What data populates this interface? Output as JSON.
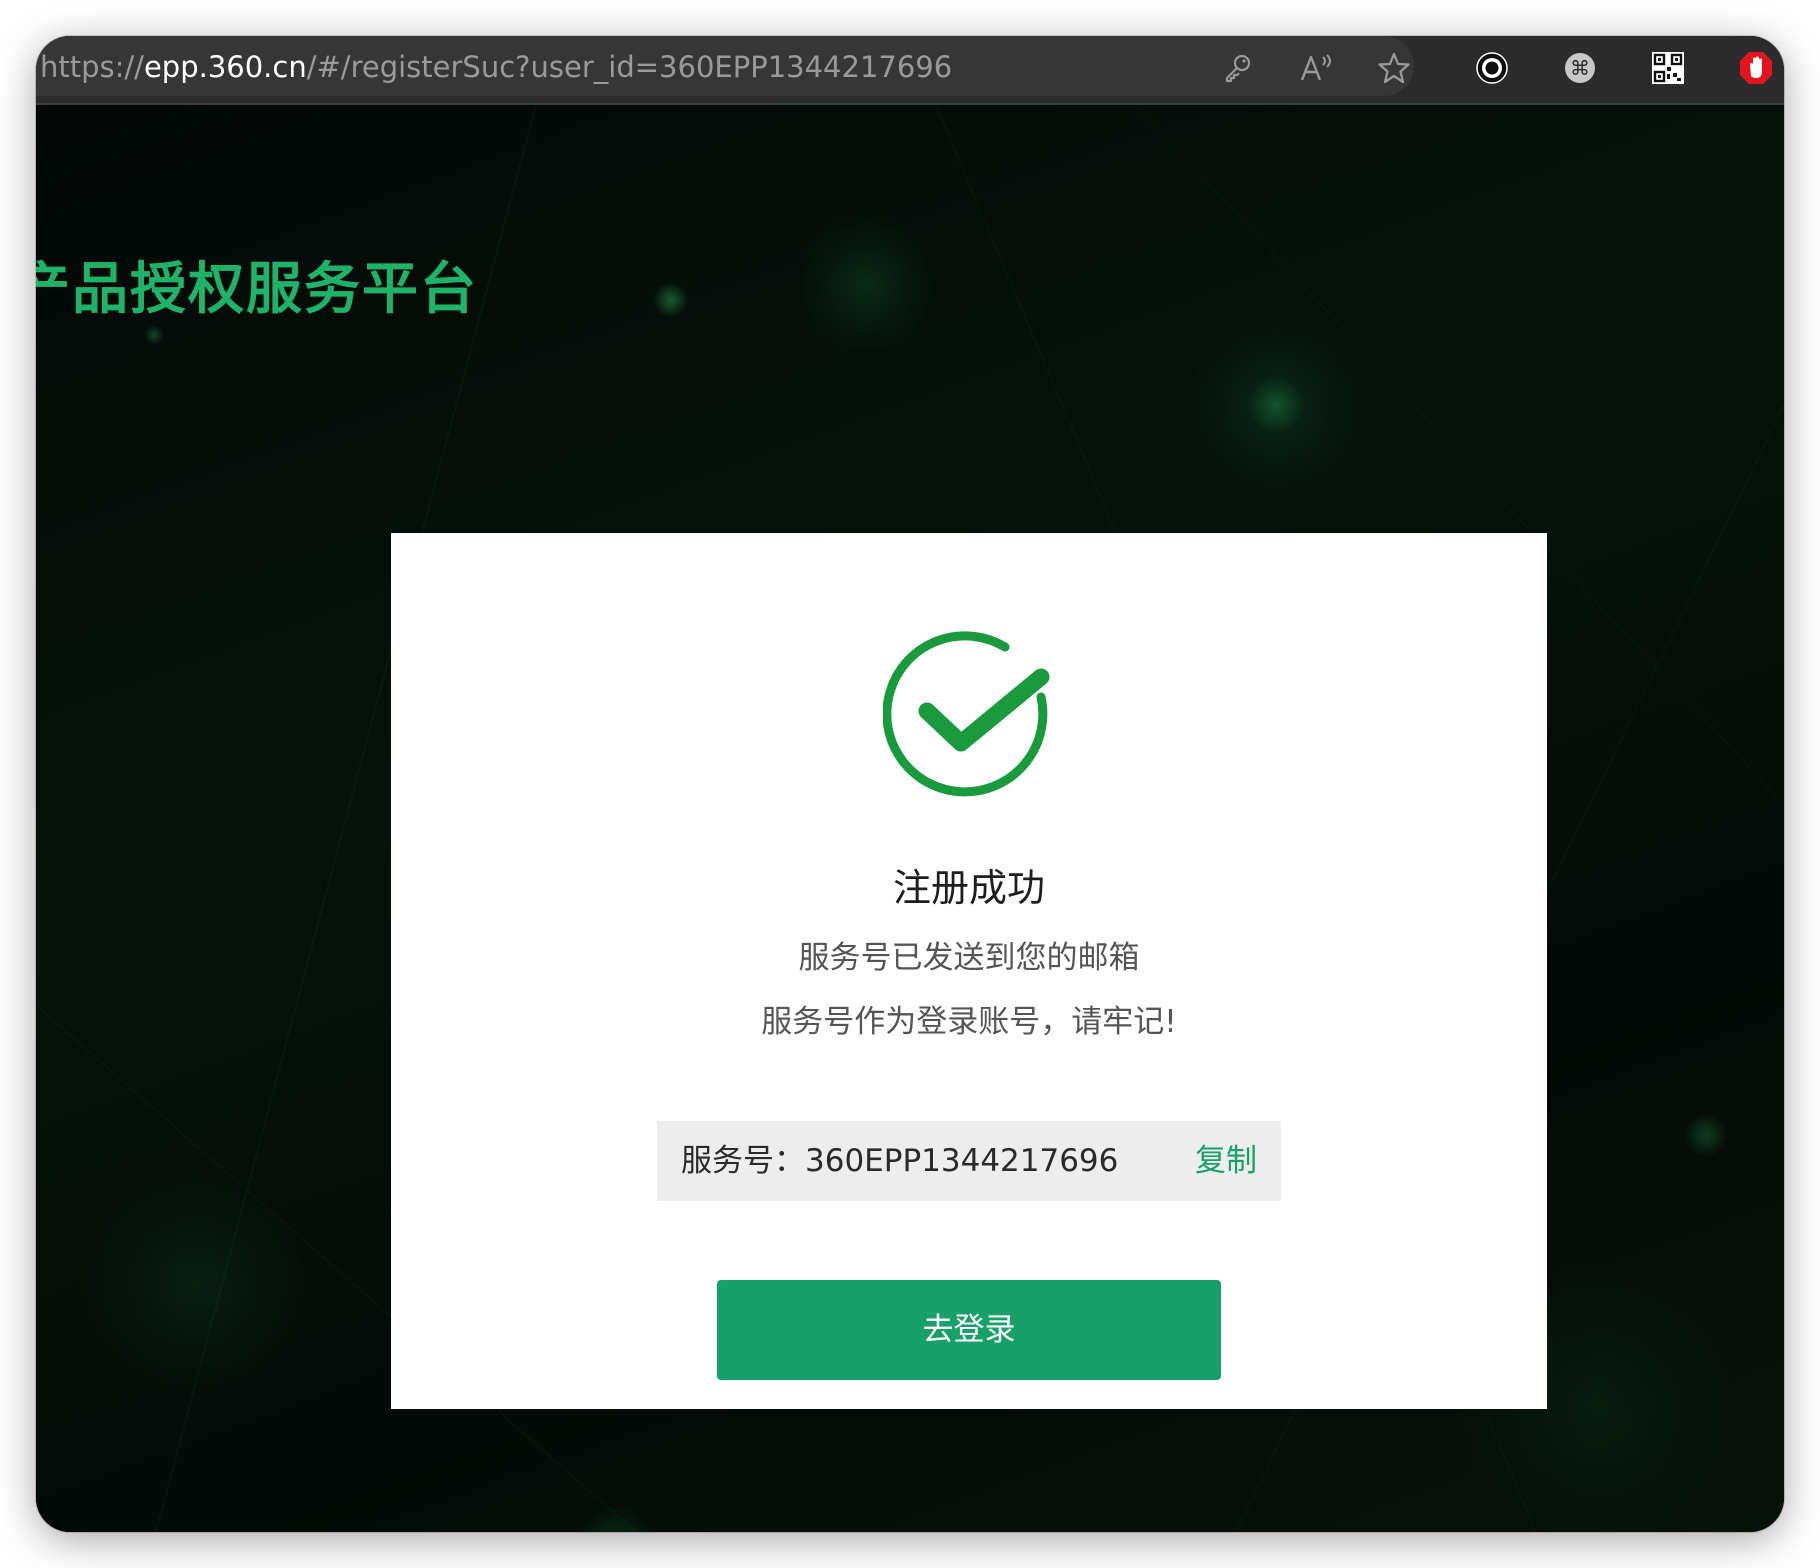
{
  "browser": {
    "url_scheme": "https://",
    "url_host": "epp.360.cn",
    "url_path": "/#/registerSuc?user_id=360EPP1344217696",
    "toolbar_icons": [
      "key-icon",
      "read-aloud-icon",
      "favorite-star-icon",
      "record-extension-icon",
      "shortcut-extension-icon",
      "qr-code-extension-icon",
      "adblock-hand-icon"
    ]
  },
  "page": {
    "brand_title": "产品授权服务平台"
  },
  "dialog": {
    "title": "注册成功",
    "line1": "服务号已发送到您的邮箱",
    "line2": "服务号作为登录账号，请牢记!",
    "service_label": "服务号：",
    "service_number": "360EPP1344217696",
    "copy_label": "复制",
    "login_label": "去登录"
  },
  "colors": {
    "accent_green": "#17a06a",
    "check_green": "#199a3c",
    "brand_green": "#1fb36a",
    "background": "#040a07"
  }
}
